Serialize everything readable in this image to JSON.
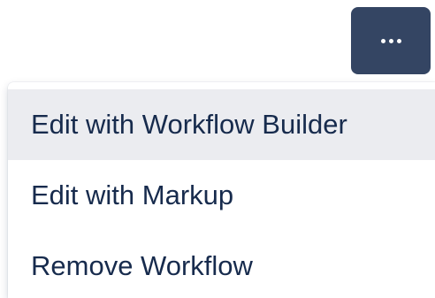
{
  "more_button": {
    "icon": "more-horizontal-icon",
    "background_color": "#344563"
  },
  "menu": {
    "items": [
      {
        "label": "Edit with Workflow Builder",
        "highlighted": true
      },
      {
        "label": "Edit with Markup",
        "highlighted": false
      },
      {
        "label": "Remove Workflow",
        "highlighted": false
      }
    ],
    "highlight_color": "#EBECF0",
    "text_color": "#172B4D"
  }
}
